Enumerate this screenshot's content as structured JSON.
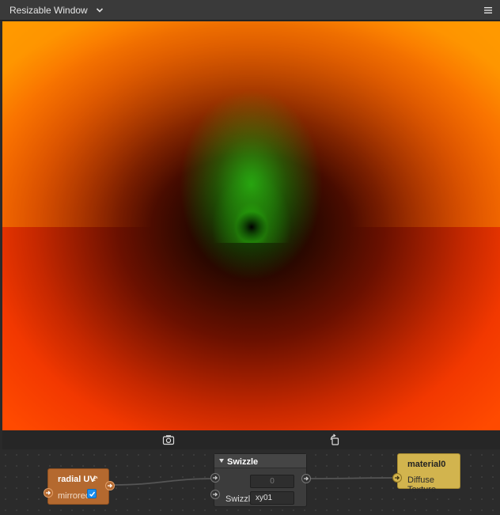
{
  "window": {
    "title": "Resizable Window",
    "icons": [
      "chevron-down-icon",
      "hamburger-menu-icon"
    ]
  },
  "viewport": {
    "description_colors": [
      "#ff4a00",
      "#ff8a00",
      "#2aa010",
      "#000000"
    ],
    "toolbar_icons": [
      "camera-screenshot-icon",
      "rotate-view-icon"
    ]
  },
  "graph": {
    "nodes": {
      "radial_uv": {
        "title": "radial UV",
        "param_label": "mirrored",
        "param_checked": true,
        "color": "#b4692f"
      },
      "swizzle": {
        "title": "Swizzle",
        "input_placeholder": "0",
        "param_label": "Swizzle",
        "param_value": "xy01",
        "color": "#3c3c3c"
      },
      "material": {
        "title": "material0",
        "input_label": "Diffuse Texture",
        "color": "#d2b44e"
      }
    }
  }
}
